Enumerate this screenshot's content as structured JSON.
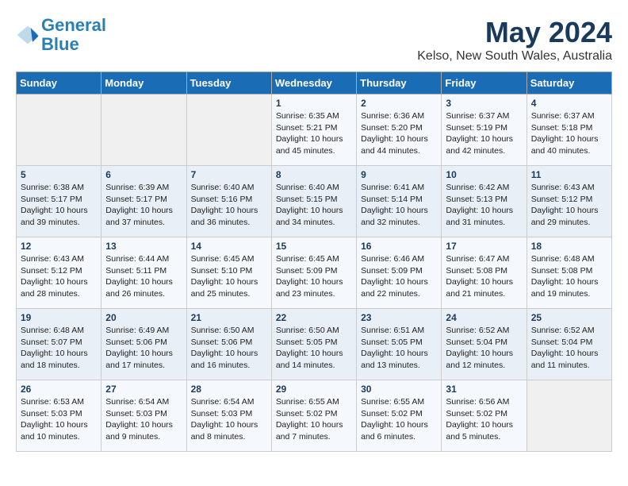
{
  "logo": {
    "text_general": "General",
    "text_blue": "Blue"
  },
  "title": "May 2024",
  "subtitle": "Kelso, New South Wales, Australia",
  "weekdays": [
    "Sunday",
    "Monday",
    "Tuesday",
    "Wednesday",
    "Thursday",
    "Friday",
    "Saturday"
  ],
  "weeks": [
    [
      {
        "day": "",
        "info": ""
      },
      {
        "day": "",
        "info": ""
      },
      {
        "day": "",
        "info": ""
      },
      {
        "day": "1",
        "info": "Sunrise: 6:35 AM\nSunset: 5:21 PM\nDaylight: 10 hours\nand 45 minutes."
      },
      {
        "day": "2",
        "info": "Sunrise: 6:36 AM\nSunset: 5:20 PM\nDaylight: 10 hours\nand 44 minutes."
      },
      {
        "day": "3",
        "info": "Sunrise: 6:37 AM\nSunset: 5:19 PM\nDaylight: 10 hours\nand 42 minutes."
      },
      {
        "day": "4",
        "info": "Sunrise: 6:37 AM\nSunset: 5:18 PM\nDaylight: 10 hours\nand 40 minutes."
      }
    ],
    [
      {
        "day": "5",
        "info": "Sunrise: 6:38 AM\nSunset: 5:17 PM\nDaylight: 10 hours\nand 39 minutes."
      },
      {
        "day": "6",
        "info": "Sunrise: 6:39 AM\nSunset: 5:17 PM\nDaylight: 10 hours\nand 37 minutes."
      },
      {
        "day": "7",
        "info": "Sunrise: 6:40 AM\nSunset: 5:16 PM\nDaylight: 10 hours\nand 36 minutes."
      },
      {
        "day": "8",
        "info": "Sunrise: 6:40 AM\nSunset: 5:15 PM\nDaylight: 10 hours\nand 34 minutes."
      },
      {
        "day": "9",
        "info": "Sunrise: 6:41 AM\nSunset: 5:14 PM\nDaylight: 10 hours\nand 32 minutes."
      },
      {
        "day": "10",
        "info": "Sunrise: 6:42 AM\nSunset: 5:13 PM\nDaylight: 10 hours\nand 31 minutes."
      },
      {
        "day": "11",
        "info": "Sunrise: 6:43 AM\nSunset: 5:12 PM\nDaylight: 10 hours\nand 29 minutes."
      }
    ],
    [
      {
        "day": "12",
        "info": "Sunrise: 6:43 AM\nSunset: 5:12 PM\nDaylight: 10 hours\nand 28 minutes."
      },
      {
        "day": "13",
        "info": "Sunrise: 6:44 AM\nSunset: 5:11 PM\nDaylight: 10 hours\nand 26 minutes."
      },
      {
        "day": "14",
        "info": "Sunrise: 6:45 AM\nSunset: 5:10 PM\nDaylight: 10 hours\nand 25 minutes."
      },
      {
        "day": "15",
        "info": "Sunrise: 6:45 AM\nSunset: 5:09 PM\nDaylight: 10 hours\nand 23 minutes."
      },
      {
        "day": "16",
        "info": "Sunrise: 6:46 AM\nSunset: 5:09 PM\nDaylight: 10 hours\nand 22 minutes."
      },
      {
        "day": "17",
        "info": "Sunrise: 6:47 AM\nSunset: 5:08 PM\nDaylight: 10 hours\nand 21 minutes."
      },
      {
        "day": "18",
        "info": "Sunrise: 6:48 AM\nSunset: 5:08 PM\nDaylight: 10 hours\nand 19 minutes."
      }
    ],
    [
      {
        "day": "19",
        "info": "Sunrise: 6:48 AM\nSunset: 5:07 PM\nDaylight: 10 hours\nand 18 minutes."
      },
      {
        "day": "20",
        "info": "Sunrise: 6:49 AM\nSunset: 5:06 PM\nDaylight: 10 hours\nand 17 minutes."
      },
      {
        "day": "21",
        "info": "Sunrise: 6:50 AM\nSunset: 5:06 PM\nDaylight: 10 hours\nand 16 minutes."
      },
      {
        "day": "22",
        "info": "Sunrise: 6:50 AM\nSunset: 5:05 PM\nDaylight: 10 hours\nand 14 minutes."
      },
      {
        "day": "23",
        "info": "Sunrise: 6:51 AM\nSunset: 5:05 PM\nDaylight: 10 hours\nand 13 minutes."
      },
      {
        "day": "24",
        "info": "Sunrise: 6:52 AM\nSunset: 5:04 PM\nDaylight: 10 hours\nand 12 minutes."
      },
      {
        "day": "25",
        "info": "Sunrise: 6:52 AM\nSunset: 5:04 PM\nDaylight: 10 hours\nand 11 minutes."
      }
    ],
    [
      {
        "day": "26",
        "info": "Sunrise: 6:53 AM\nSunset: 5:03 PM\nDaylight: 10 hours\nand 10 minutes."
      },
      {
        "day": "27",
        "info": "Sunrise: 6:54 AM\nSunset: 5:03 PM\nDaylight: 10 hours\nand 9 minutes."
      },
      {
        "day": "28",
        "info": "Sunrise: 6:54 AM\nSunset: 5:03 PM\nDaylight: 10 hours\nand 8 minutes."
      },
      {
        "day": "29",
        "info": "Sunrise: 6:55 AM\nSunset: 5:02 PM\nDaylight: 10 hours\nand 7 minutes."
      },
      {
        "day": "30",
        "info": "Sunrise: 6:55 AM\nSunset: 5:02 PM\nDaylight: 10 hours\nand 6 minutes."
      },
      {
        "day": "31",
        "info": "Sunrise: 6:56 AM\nSunset: 5:02 PM\nDaylight: 10 hours\nand 5 minutes."
      },
      {
        "day": "",
        "info": ""
      }
    ]
  ]
}
